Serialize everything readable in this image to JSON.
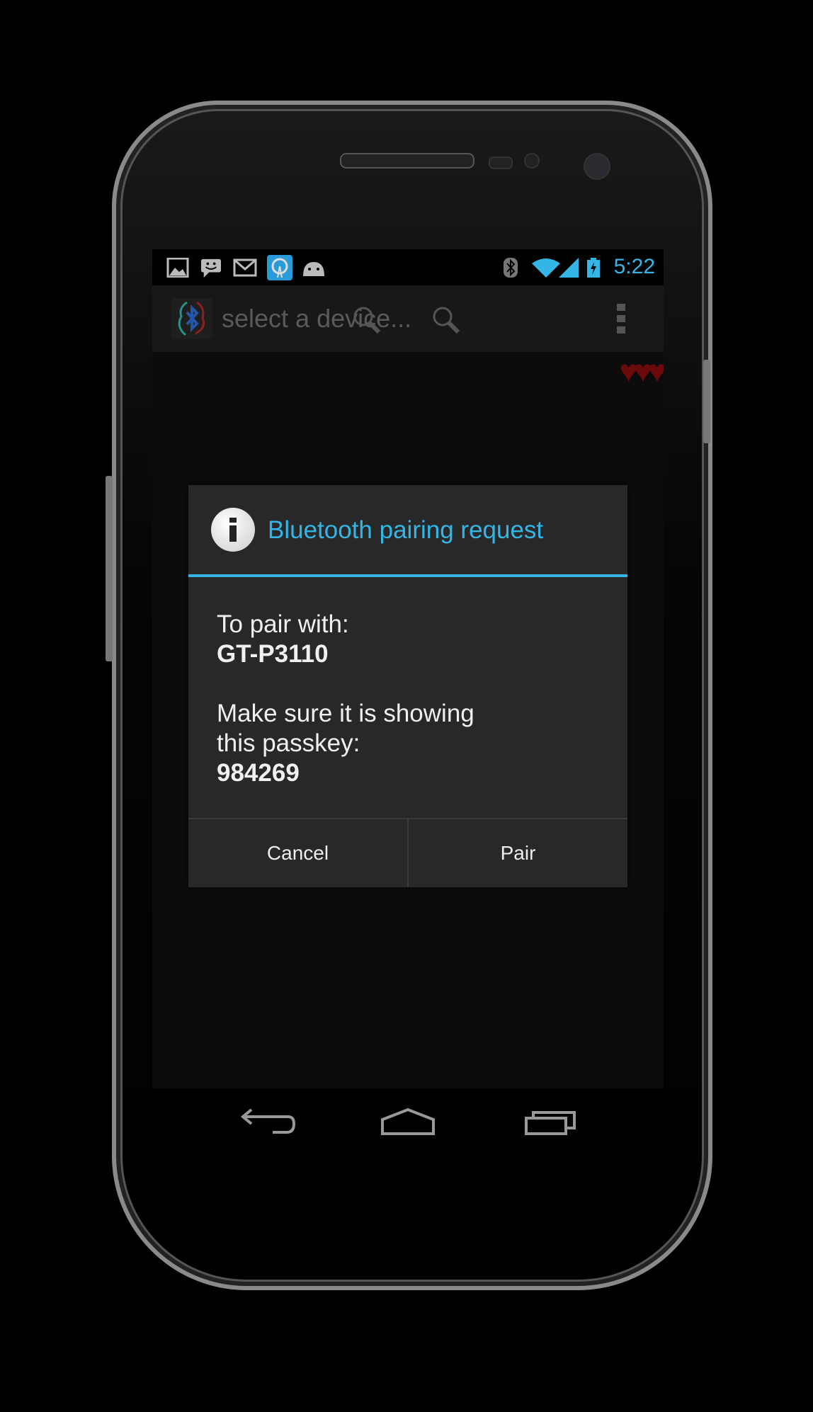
{
  "status_bar": {
    "notification_icons": [
      "gallery-icon",
      "messaging-icon",
      "gmail-icon",
      "radio-app-icon",
      "android-icon"
    ],
    "system_icons": [
      "bluetooth-icon",
      "wifi-icon",
      "signal-icon",
      "battery-charging-icon"
    ],
    "time": "5:22",
    "accent_color": "#33b5e5"
  },
  "action_bar": {
    "title": "select a device...",
    "actions": [
      "search-icon",
      "search-icon",
      "overflow-menu-icon"
    ]
  },
  "hearts": {
    "count": 3,
    "color": "#6a0a0a",
    "glyph": "♥♥♥"
  },
  "dialog": {
    "title": "Bluetooth pairing request",
    "icon": "info-icon",
    "line1": "To pair with:",
    "device_name": "GT-P3110",
    "line2": "Make sure it is showing this passkey:",
    "passkey": "984269",
    "cancel_label": "Cancel",
    "pair_label": "Pair"
  },
  "nav_bar": {
    "buttons": [
      "back-icon",
      "home-icon",
      "recents-icon"
    ]
  }
}
